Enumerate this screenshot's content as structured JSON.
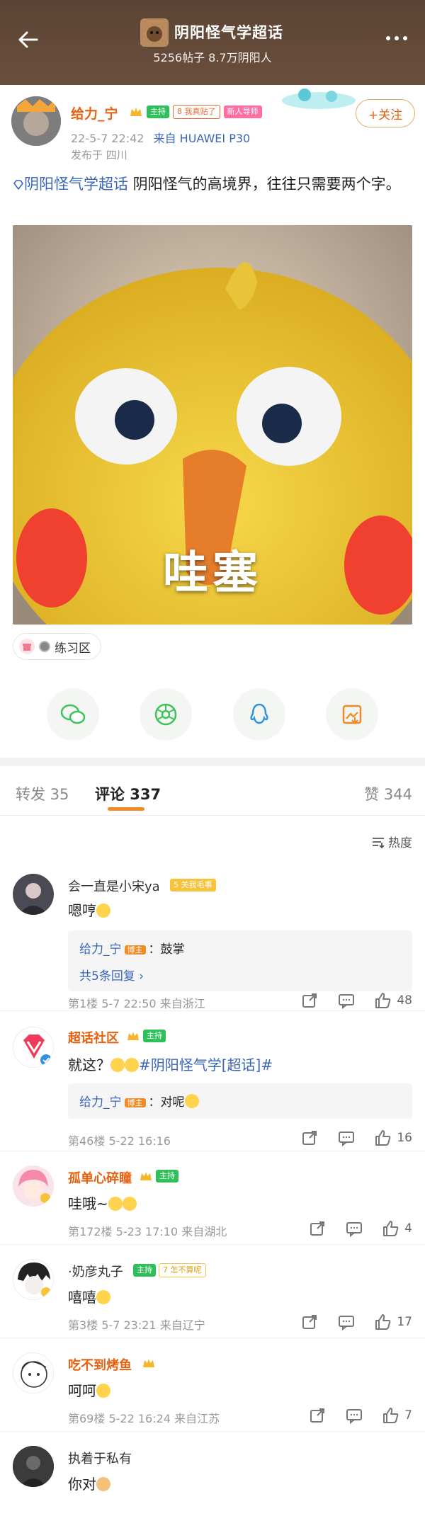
{
  "header": {
    "title": "阴阳怪气学超话",
    "subtitle": "5256帖子 8.7万阴阳人"
  },
  "post": {
    "author": "给力_宁",
    "badge_host": "主持",
    "badge_level_num": "8",
    "badge_level_text": "我真贴了",
    "badge_newbie": "新人导师",
    "date": "22-5-7 22:42",
    "from_label": "来自",
    "device": "HUAWEI P30",
    "location": "发布于 四川",
    "follow_label": "+关注",
    "topic": "阴阳怪气学超话",
    "text": " 阴阳怪气的高境界，往往只需要两个字。",
    "image_caption": "哇塞",
    "tag": "练习区"
  },
  "tabs": {
    "repost": "转发 35",
    "comments": "评论 337",
    "likes": "赞 344",
    "sort": "热度"
  },
  "comments": [
    {
      "name": "会一直是小宋ya",
      "badge_num": "5",
      "badge_text": "关我毛事",
      "text": "嗯哼",
      "reply_author": "给力_宁",
      "reply_owner_badge": "博主",
      "reply_text": "：鼓掌",
      "more_replies": "共5条回复 ›",
      "floor": "第1楼",
      "date": "5-7 22:50",
      "loc": "来自浙江",
      "likes": "48"
    },
    {
      "name": "超话社区",
      "badge_host": "主持",
      "text": "就这？",
      "text_topic": "#阴阳怪气学[超话]#",
      "reply_author": "给力_宁",
      "reply_owner_badge": "博主",
      "reply_text": "：对呢",
      "floor": "第46楼",
      "date": "5-22 16:16",
      "likes": "16"
    },
    {
      "name": "孤单心碎瞳",
      "badge_host": "主持",
      "text": "哇哦~",
      "floor": "第172楼",
      "date": "5-23 17:10",
      "loc": "来自湖北",
      "likes": "4"
    },
    {
      "name": "·奶彦丸子",
      "badge_host": "主持",
      "badge_num": "7",
      "badge_text": "怎不算呢",
      "text": "嘻嘻",
      "floor": "第3楼",
      "date": "5-7 23:21",
      "loc": "来自辽宁",
      "likes": "17"
    },
    {
      "name": "吃不到烤鱼",
      "text": "呵呵",
      "floor": "第69楼",
      "date": "5-22 16:24",
      "loc": "来自江苏",
      "likes": "7"
    },
    {
      "name": "执着于私有",
      "text": "你对"
    }
  ],
  "colors": {
    "accent": "#e8610f",
    "link": "#3a66b8",
    "host_badge": "#2fbf5b",
    "header_bg": "#5b4333"
  }
}
